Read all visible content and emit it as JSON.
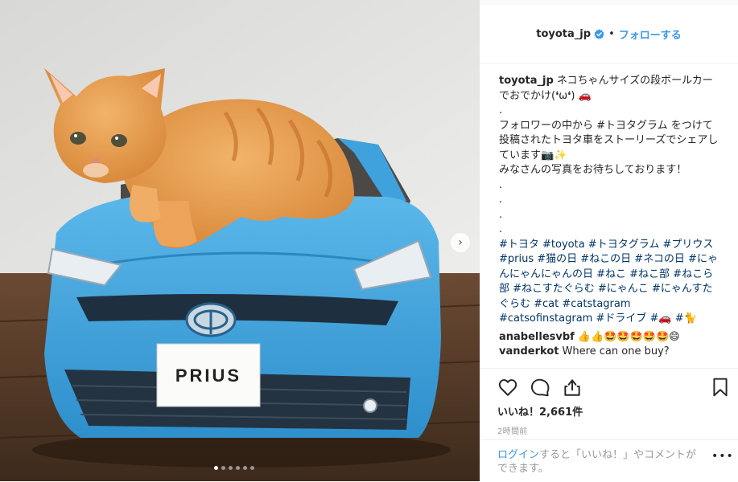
{
  "post": {
    "username": "toyota_jp",
    "separator": "•",
    "follow_label": "フォローする"
  },
  "caption": {
    "username": "toyota_jp",
    "lines": [
      "ネコちゃんサイズの段ボールカーでおでかけ(❛ω❛) 🚗",
      ".",
      "フォロワーの中から #トヨタグラム をつけて投稿されたトヨタ車をストーリーズでシェアしています📷✨",
      "みなさんの写真をお待ちしております！",
      ".",
      ".",
      ".",
      "."
    ],
    "hashtags": "#トヨタ #toyota #トヨタグラム #プリウス #prius #猫の日 #ねこの日 #ネコの日 #にゃんにゃんにゃんの日 #ねこ #ねこ部 #ねこら部 #ねこすたぐらむ #にゃんこ #にゃんすたぐらむ #cat #catstagram #catsofinstagram #ドライブ #🚗 #🐈"
  },
  "comments": [
    {
      "username": "anabellesvbf",
      "text": "👍👍🤩🤩🤩🤩🤩😄"
    },
    {
      "username": "vanderkot",
      "text": "Where can one buy?"
    }
  ],
  "likes_text": "いいね！2,661件",
  "time_text": "2時間前",
  "login": {
    "link": "ログイン",
    "rest": "すると「いいね！」やコメントができます。",
    "more": "•••"
  },
  "photo": {
    "plate_text": "PRIUS",
    "carousel_count": 6,
    "carousel_active": 1
  },
  "colors": {
    "link_blue": "#3897f0",
    "hashtag": "#003569",
    "car_blue": "#3fa2dd"
  }
}
